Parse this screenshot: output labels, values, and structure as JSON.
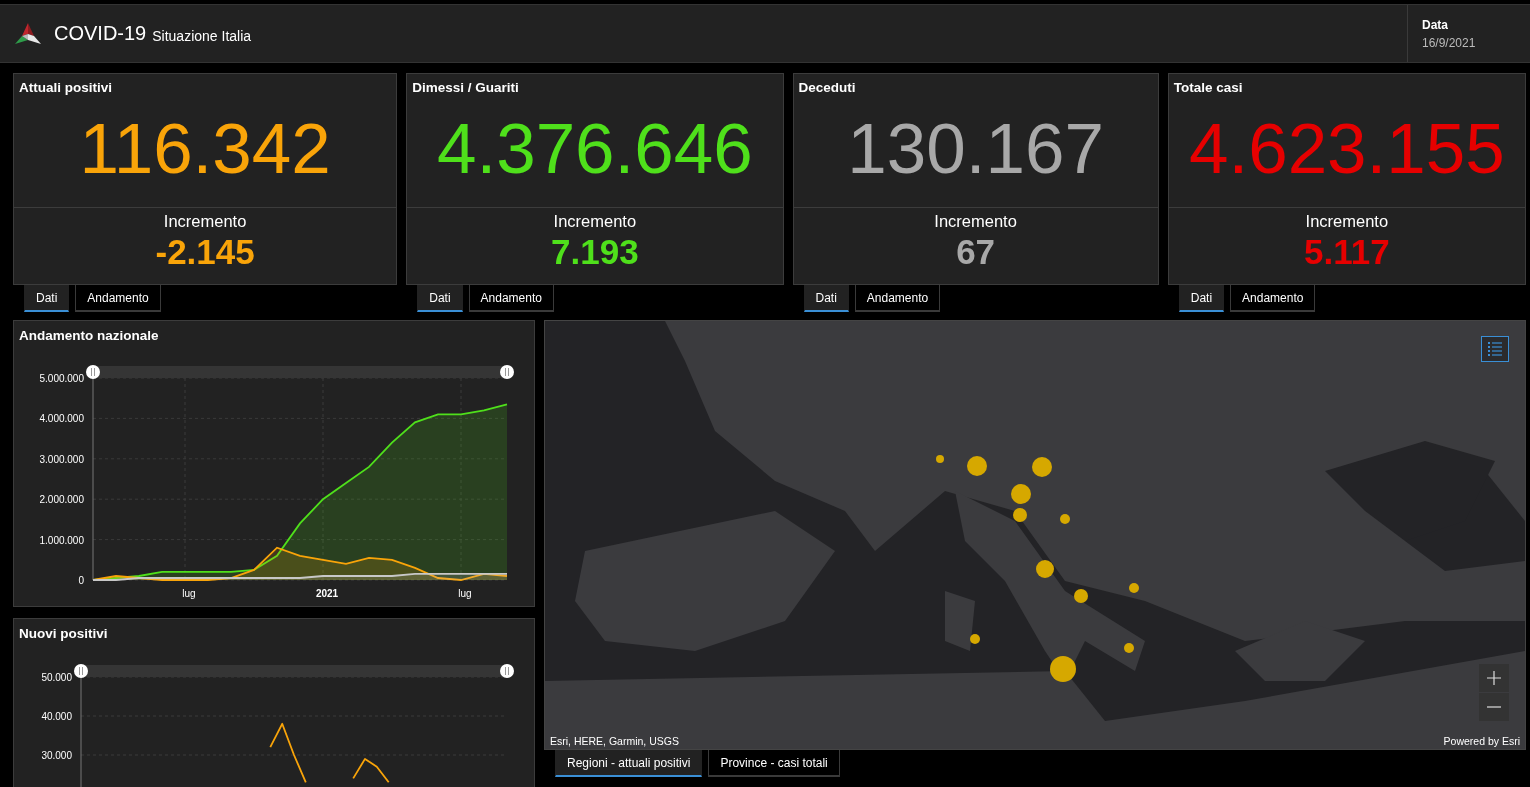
{
  "header": {
    "title": "COVID-19",
    "subtitle": "Situazione Italia",
    "date_label": "Data",
    "date": "16/9/2021"
  },
  "cards": [
    {
      "title": "Attuali positivi",
      "value": "116.342",
      "increment_label": "Incremento",
      "increment": "-2.145",
      "color": "#f9a409",
      "tabs": [
        {
          "label": "Dati",
          "selected": true
        },
        {
          "label": "Andamento",
          "selected": false
        }
      ]
    },
    {
      "title": "Dimessi / Guariti",
      "value": "4.376.646",
      "increment_label": "Incremento",
      "increment": "7.193",
      "color": "#4fe01b",
      "tabs": [
        {
          "label": "Dati",
          "selected": true
        },
        {
          "label": "Andamento",
          "selected": false
        }
      ]
    },
    {
      "title": "Deceduti",
      "value": "130.167",
      "increment_label": "Incremento",
      "increment": "67",
      "color": "#a8a8a8",
      "tabs": [
        {
          "label": "Dati",
          "selected": true
        },
        {
          "label": "Andamento",
          "selected": false
        }
      ]
    },
    {
      "title": "Totale casi",
      "value": "4.623.155",
      "increment_label": "Incremento",
      "increment": "5.117",
      "color": "#e60000",
      "tabs": [
        {
          "label": "Dati",
          "selected": true
        },
        {
          "label": "Andamento",
          "selected": false
        }
      ]
    }
  ],
  "charts": [
    {
      "title": "Andamento nazionale",
      "chart_data": {
        "type": "area",
        "grid": true,
        "categories": [
          null,
          null,
          null,
          null,
          "lug",
          null,
          null,
          null,
          null,
          null,
          "2021",
          null,
          null,
          null,
          null,
          null,
          "lug",
          null,
          null
        ],
        "ylim": [
          0,
          5000000
        ],
        "yticks": [
          {
            "value": 0,
            "label": "0"
          },
          {
            "value": 1000000,
            "label": "1.000.000"
          },
          {
            "value": 2000000,
            "label": "2.000.000"
          },
          {
            "value": 3000000,
            "label": "3.000.000"
          },
          {
            "value": 4000000,
            "label": "4.000.000"
          },
          {
            "value": 5000000,
            "label": "5.000.000"
          }
        ],
        "series": [
          {
            "color": "#4fe01b",
            "values": [
              0,
              50000,
              100000,
              200000,
              200000,
              200000,
              200000,
              250000,
              600000,
              1400000,
              2000000,
              2400000,
              2800000,
              3400000,
              3900000,
              4100000,
              4100000,
              4200000,
              4350000
            ]
          },
          {
            "color": "#f9a409",
            "values": [
              0,
              100000,
              50000,
              0,
              0,
              0,
              50000,
              250000,
              800000,
              600000,
              500000,
              400000,
              550000,
              500000,
              300000,
              50000,
              0,
              150000,
              100000
            ]
          },
          {
            "color": "#c8c8c8",
            "values": [
              0,
              0,
              50000,
              50000,
              50000,
              50000,
              50000,
              50000,
              50000,
              50000,
              100000,
              100000,
              100000,
              100000,
              150000,
              150000,
              150000,
              150000,
              150000
            ]
          }
        ]
      }
    },
    {
      "title": "Nuovi positivi",
      "chart_data": {
        "type": "line",
        "grid": true,
        "categories": [
          null,
          null,
          null,
          null,
          null,
          null,
          null,
          null,
          null,
          null,
          null,
          null,
          null,
          null,
          null,
          null,
          null,
          null,
          null,
          null,
          null,
          null,
          null,
          null,
          null,
          null,
          null,
          null,
          null,
          null,
          null,
          null,
          null,
          null,
          null,
          null,
          null
        ],
        "ylim": [
          0,
          50000
        ],
        "yticks": [
          {
            "value": 30000,
            "label": "30.000"
          },
          {
            "value": 40000,
            "label": "40.000"
          },
          {
            "value": 50000,
            "label": "50.000"
          }
        ],
        "series": [
          {
            "color": "#f9a409",
            "values": [
              null,
              null,
              null,
              null,
              null,
              null,
              null,
              null,
              null,
              null,
              null,
              null,
              null,
              null,
              null,
              null,
              32000,
              38000,
              30000,
              23000,
              null,
              null,
              null,
              24000,
              29000,
              27000,
              23000,
              null,
              null,
              null,
              null,
              null,
              null,
              null,
              null,
              null,
              null
            ]
          }
        ]
      }
    }
  ],
  "map": {
    "attribution": "Esri, HERE, Garmin, USGS",
    "powered_by": "Powered by Esri",
    "tabs": [
      {
        "label": "Regioni - attuali positivi",
        "selected": true
      },
      {
        "label": "Province - casi totali",
        "selected": false
      }
    ]
  }
}
